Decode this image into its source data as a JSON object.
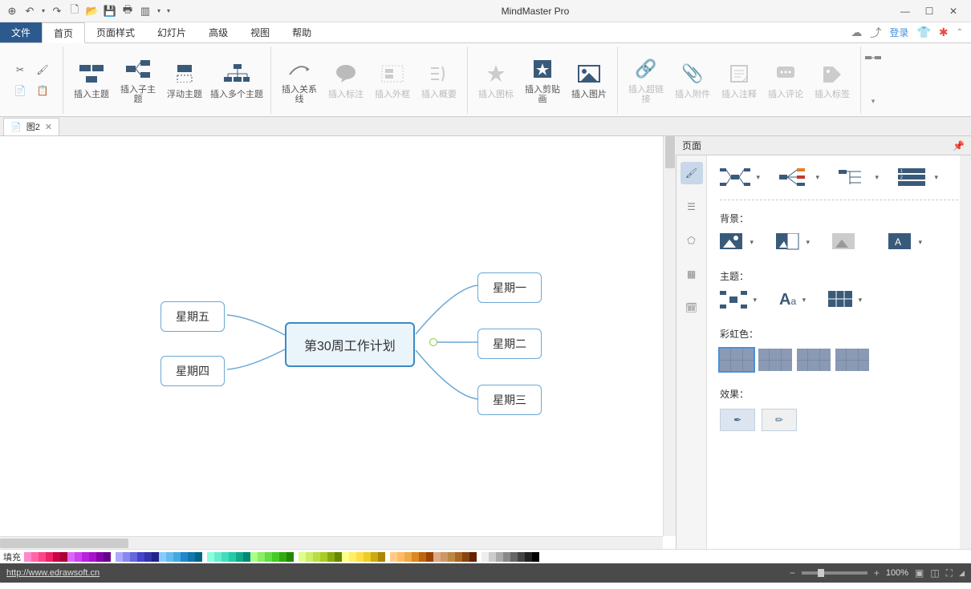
{
  "app": {
    "title": "MindMaster Pro"
  },
  "menu": {
    "file": "文件",
    "tabs": [
      "首页",
      "页面样式",
      "幻灯片",
      "高级",
      "视图",
      "帮助"
    ],
    "login": "登录"
  },
  "ribbon": {
    "insert_topic": "插入主题",
    "insert_subtopic": "插入子主题",
    "floating_topic": "浮动主题",
    "insert_multiple": "插入多个主题",
    "insert_relation": "插入关系线",
    "insert_callout": "插入标注",
    "insert_boundary": "插入外框",
    "insert_summary": "插入概要",
    "insert_icon": "插入图标",
    "insert_clipart": "插入剪贴画",
    "insert_image": "插入图片",
    "insert_hyperlink": "插入超链接",
    "insert_attachment": "插入附件",
    "insert_note": "插入注释",
    "insert_comment": "插入评论",
    "insert_tag": "插入标签"
  },
  "doctab": {
    "name": "图2"
  },
  "mindmap": {
    "center": "第30周工作计划",
    "n1": "星期一",
    "n2": "星期二",
    "n3": "星期三",
    "n4": "星期四",
    "n5": "星期五"
  },
  "sidepanel": {
    "title": "页面",
    "background": "背景：",
    "topic": "主题：",
    "rainbow": "彩虹色：",
    "effect": "效果："
  },
  "colorbar": {
    "label": "填充"
  },
  "status": {
    "link": "http://www.edrawsoft.cn",
    "zoom": "100%"
  }
}
